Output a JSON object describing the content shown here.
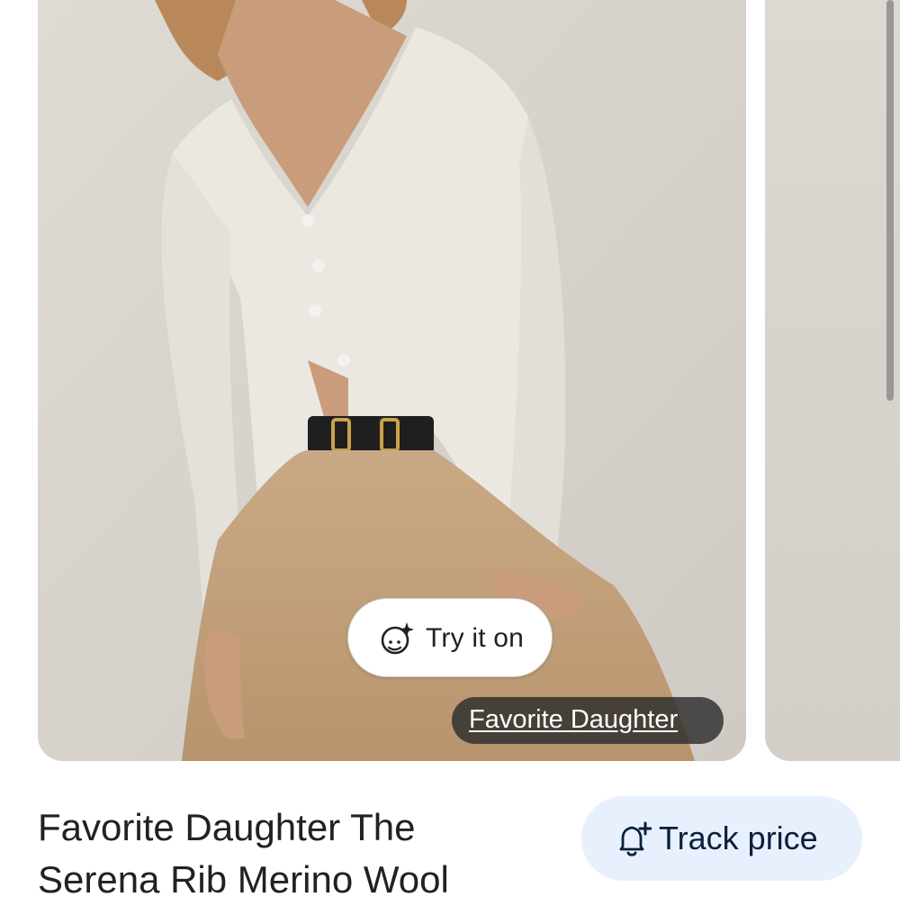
{
  "product": {
    "image_alt": "Model wearing a cream ribbed cardigan with tan trousers",
    "try_on_label": "Try it on",
    "brand_chip": "Favorite Daughter",
    "title_line1": "Favorite Daughter The",
    "title_line2": "Serena Rib Merino Wool",
    "track_price_label": "Track price"
  },
  "icons": {
    "try_on": "sparkle-face-icon",
    "track_price": "bell-add-icon"
  },
  "colors": {
    "track_button_bg": "#e8f0fe",
    "brand_chip_bg": "#2d2d2d"
  }
}
